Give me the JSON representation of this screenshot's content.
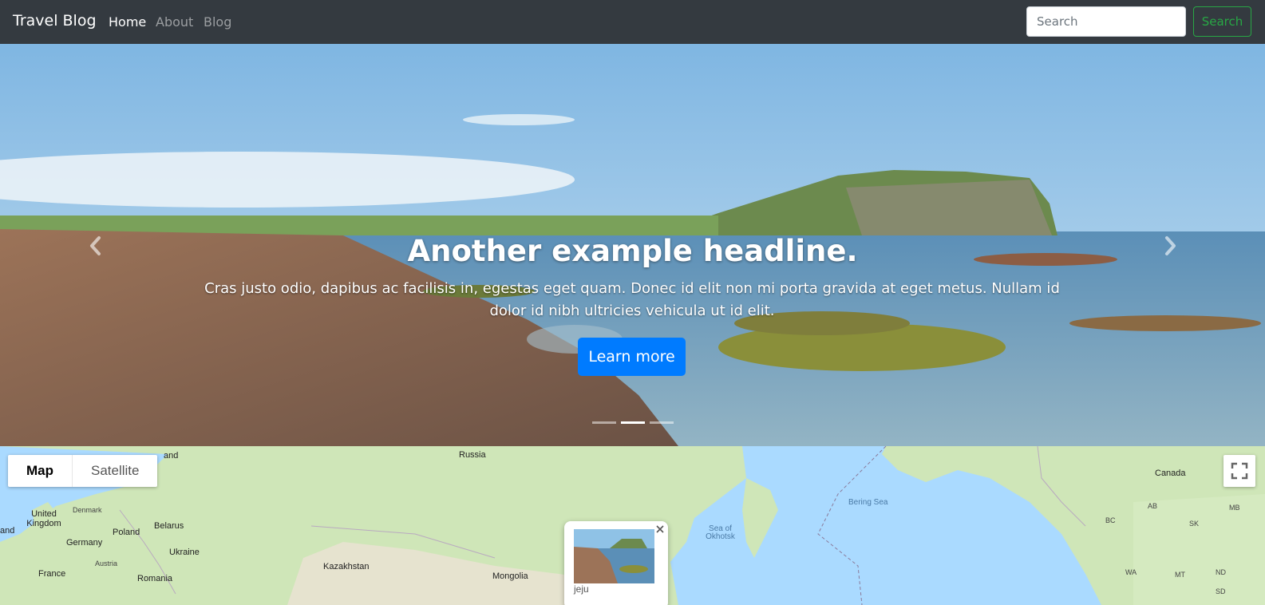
{
  "navbar": {
    "brand": "Travel Blog",
    "links": [
      {
        "label": "Home",
        "active": true
      },
      {
        "label": "About",
        "active": false
      },
      {
        "label": "Blog",
        "active": false
      }
    ],
    "search": {
      "placeholder": "Search",
      "button_label": "Search"
    }
  },
  "hero": {
    "headline": "Another example headline.",
    "text": "Cras justo odio, dapibus ac facilisis in, egestas eget quam. Donec id elit non mi porta gravida at eget metus. Nullam id dolor id nibh ultricies vehicula ut id elit.",
    "button_label": "Learn more",
    "slide_count": 3,
    "active_slide": 2
  },
  "map": {
    "type_buttons": [
      {
        "label": "Map",
        "active": true
      },
      {
        "label": "Satellite",
        "active": false
      }
    ],
    "labels": {
      "russia": "Russia",
      "canada": "Canada",
      "united_kingdom": "United Kingdom",
      "denmark": "Denmark",
      "belarus": "Belarus",
      "poland": "Poland",
      "germany": "Germany",
      "ukraine": "Ukraine",
      "austria": "Austria",
      "france": "France",
      "romania": "Romania",
      "kazakhstan": "Kazakhstan",
      "mongolia": "Mongolia",
      "ireland_fragment": "and",
      "land_fragment": "and",
      "sea_of_okhotsk": "Sea of Okhotsk",
      "bering_sea": "Bering Sea",
      "ab": "AB",
      "bc": "BC",
      "mb": "MB",
      "sk": "SK",
      "wa": "WA",
      "mt": "MT",
      "nd": "ND",
      "sd": "SD"
    },
    "info_window": {
      "label": "jeju"
    }
  },
  "colors": {
    "navbar_bg": "#343a40",
    "primary": "#007bff",
    "success": "#28a745",
    "map_water": "#aadaff",
    "map_land": "#cfe6b8"
  }
}
